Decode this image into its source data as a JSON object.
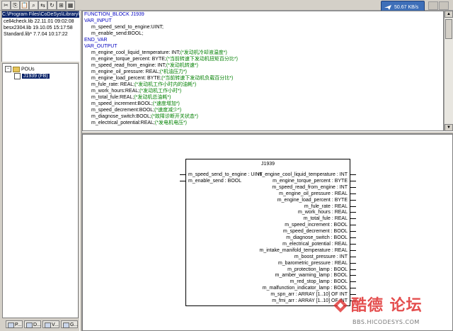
{
  "toolbar": {
    "buttons": [
      "✂",
      "⎘",
      "📋",
      "⌕",
      "⇆",
      "↻",
      "⊞",
      "▦"
    ],
    "network_speed": "50.67 KB/s"
  },
  "libraries": {
    "path": "C:\\Program Files\\CoDeSys\\Library\\J",
    "items": [
      "cell4check.lib 22.11.01 09:02:08",
      "besx2304.lib 19.10.05 15:17:58",
      "Standard.lib* 7.7.04 10:17:22"
    ]
  },
  "tree": {
    "folder_label": "POUs",
    "pou_label": "J1939 (FB)"
  },
  "bottom_tabs": [
    "P...",
    "D...",
    "V...",
    "G..."
  ],
  "declaration": {
    "lines": [
      {
        "kind": "kw",
        "text": "FUNCTION_BLOCK J1939"
      },
      {
        "kind": "kw",
        "text": "VAR_INPUT"
      },
      {
        "kind": "var",
        "text": "m_speed_send_to_engine:UINT;",
        "indent": 2
      },
      {
        "kind": "var",
        "text": "m_enable_send:BOOL;",
        "indent": 2
      },
      {
        "kind": "kw",
        "text": "END_VAR"
      },
      {
        "kind": "kw",
        "text": "VAR_OUTPUT"
      },
      {
        "kind": "var",
        "text": "m_engine_cool_liquid_temperature: INT;",
        "comment": "(*发动机冷却液温度*)",
        "indent": 2
      },
      {
        "kind": "var",
        "text": "m_engine_torque_percent: BYTE;",
        "comment": "(*当前转速下发动机扭矩百分比*)",
        "indent": 2
      },
      {
        "kind": "var",
        "text": "m_speed_read_from_engine: INT;",
        "comment": "(*发动机转速*)",
        "indent": 2
      },
      {
        "kind": "var",
        "text": "m_engine_oil_pressure: REAL;",
        "comment": "(*机油压力*)",
        "indent": 2
      },
      {
        "kind": "var",
        "text": "m_engine_load_percent: BYTE;",
        "comment": "(*当前转速下发动机负载百分比*)",
        "indent": 2
      },
      {
        "kind": "var",
        "text": "m_fule_rate: REAL;",
        "comment": "(*发动机工作小时内的油耗*)",
        "indent": 2
      },
      {
        "kind": "var",
        "text": "m_work_hours:REAL;",
        "comment": "(*发动机工作小时*)",
        "indent": 2
      },
      {
        "kind": "var",
        "text": "m_total_fule:REAL;",
        "comment": "(*发动机总油耗*)",
        "indent": 2
      },
      {
        "kind": "var",
        "text": "m_speed_increment:BOOL;",
        "comment": "(*速度增加*)",
        "indent": 2
      },
      {
        "kind": "var",
        "text": "m_speed_decrement:BOOL;",
        "comment": "(*速度减少*)",
        "indent": 2
      },
      {
        "kind": "var",
        "text": "m_diagnose_switch:BOOL;",
        "comment": "(*故障诊断开关状态*)",
        "indent": 2
      },
      {
        "kind": "var",
        "text": "m_electrical_potential:REAL;",
        "comment": "(*发电机电压*)",
        "indent": 2
      }
    ]
  },
  "fb": {
    "name": "J1939",
    "inputs": [
      "m_speed_send_to_engine : UINT",
      "m_enable_send : BOOL"
    ],
    "outputs": [
      "m_engine_cool_liquid_temperature : INT",
      "m_engine_torque_percent : BYTE",
      "m_speed_read_from_engine : INT",
      "m_engine_oil_pressure : REAL",
      "m_engine_load_percent : BYTE",
      "m_fule_rate : REAL",
      "m_work_hours : REAL",
      "m_total_fule : REAL",
      "m_speed_increment : BOOL",
      "m_speed_decrement : BOOL",
      "m_diagnose_switch : BOOL",
      "m_electrical_potential : REAL",
      "m_intake_manifold_temperature : REAL",
      "m_boost_pressure : INT",
      "m_barometric_pressure : REAL",
      "m_protection_lamp : BOOL",
      "m_amber_warning_lamp : BOOL",
      "m_red_stop_lamp : BOOL",
      "m_malfunction_indicator_lamp : BOOL",
      "m_spn_arr : ARRAY [1..10] OF INT",
      "m_fmi_arr : ARRAY [1..10] OF INT"
    ]
  },
  "watermark": {
    "cn": "酷德 论坛",
    "url": "BBS.HICODESYS.COM"
  },
  "colors": {
    "keyword": "#0000c0",
    "comment": "#008000",
    "selection": "#0a246a"
  }
}
